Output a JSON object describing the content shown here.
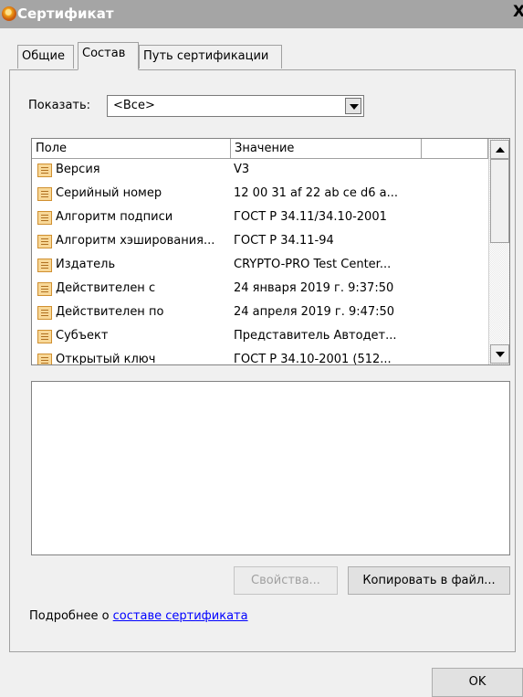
{
  "window": {
    "title": "Сертификат",
    "close_glyph": "X"
  },
  "tabs": [
    {
      "label": "Общие"
    },
    {
      "label": "Состав"
    },
    {
      "label": "Путь сертификации"
    }
  ],
  "show": {
    "label": "Показать:",
    "value": "<Все>"
  },
  "table": {
    "columns": [
      "Поле",
      "Значение"
    ],
    "rows": [
      {
        "field": "Версия",
        "value": "V3"
      },
      {
        "field": "Серийный номер",
        "value": "12 00 31 af 22 ab ce d6 a..."
      },
      {
        "field": "Алгоритм подписи",
        "value": "ГОСТ Р 34.11/34.10-2001"
      },
      {
        "field": "Алгоритм хэширования...",
        "value": "ГОСТ Р 34.11-94"
      },
      {
        "field": "Издатель",
        "value": "CRYPTO-PRO Test Center..."
      },
      {
        "field": "Действителен с",
        "value": "24 января 2019 г. 9:37:50"
      },
      {
        "field": "Действителен по",
        "value": "24 апреля 2019 г. 9:47:50"
      },
      {
        "field": "Субъект",
        "value": "Представитель Автодет..."
      },
      {
        "field": "Открытый ключ",
        "value": "ГОСТ Р 34.10-2001 (512..."
      }
    ]
  },
  "buttons": {
    "properties": "Свойства...",
    "copy": "Копировать в файл...",
    "ok": "OK"
  },
  "footer": {
    "text": "Подробнее о ",
    "link": "составе сертификата"
  }
}
